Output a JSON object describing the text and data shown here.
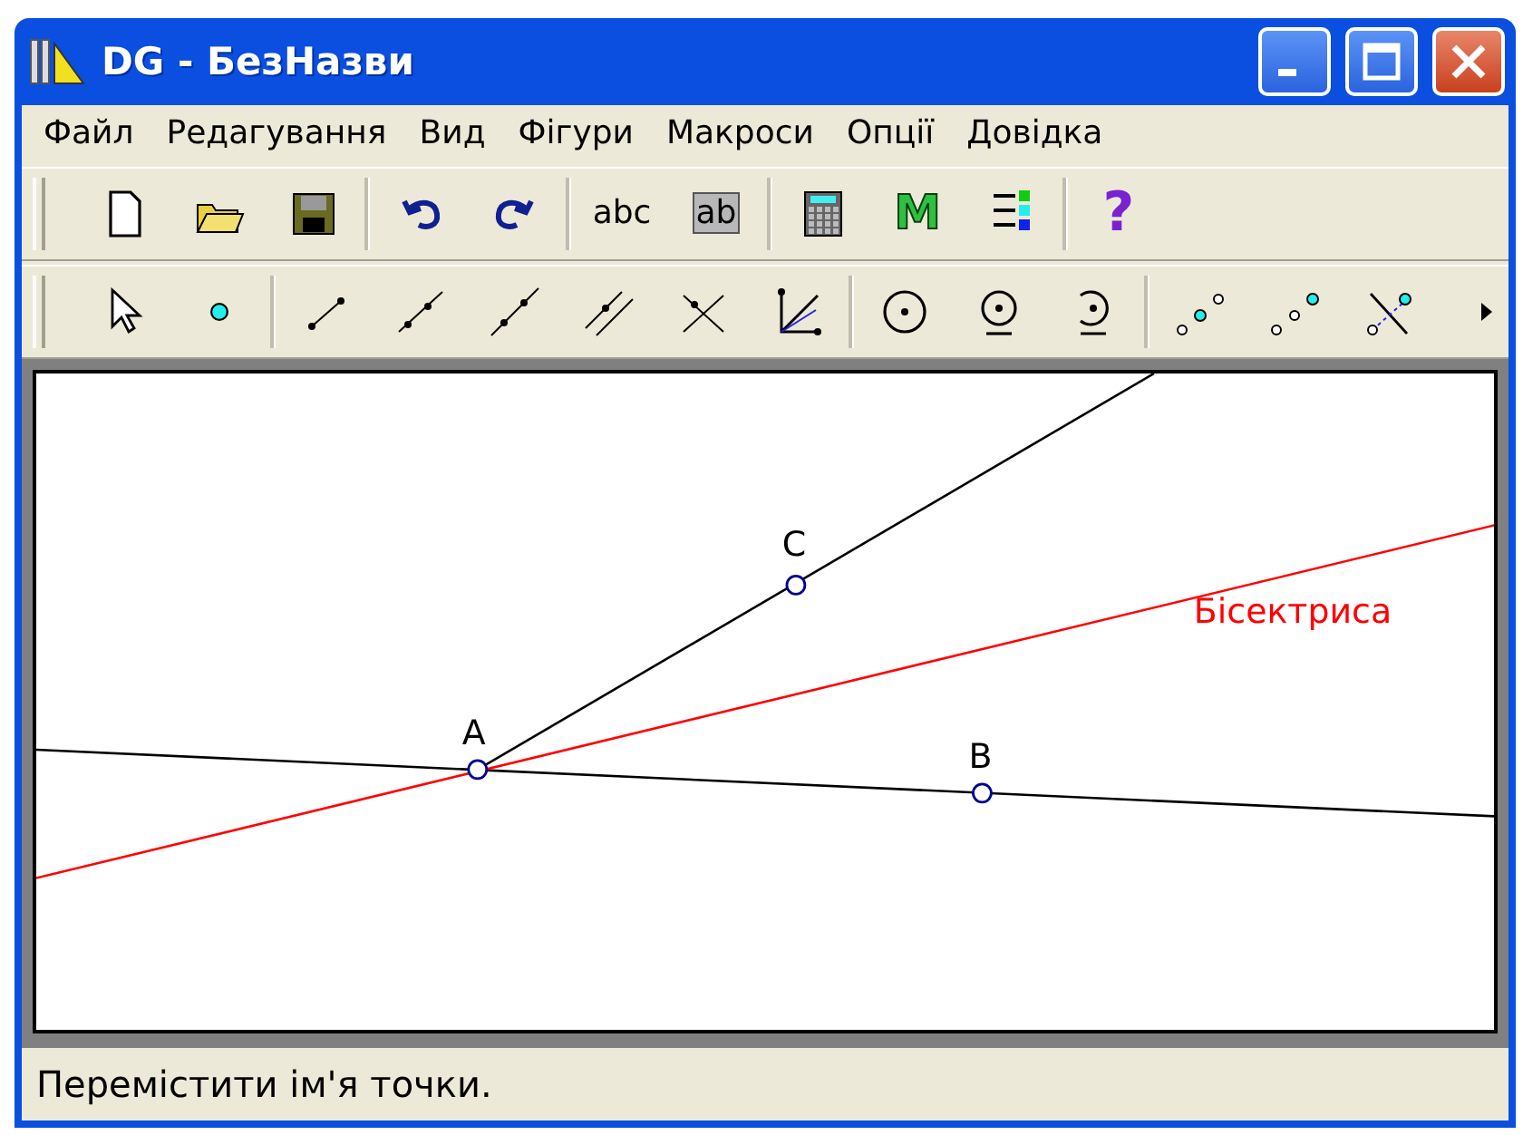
{
  "window": {
    "title": "DG - БезНазви"
  },
  "menu": [
    "Файл",
    "Редагування",
    "Вид",
    "Фігури",
    "Макроси",
    "Опції",
    "Довідка"
  ],
  "toolbar": {
    "text_button": "abc",
    "label_button": "ab",
    "macro_button": "M",
    "help_button": "?"
  },
  "canvas": {
    "points": [
      {
        "label": "A"
      },
      {
        "label": "B"
      },
      {
        "label": "C"
      }
    ],
    "lines": [
      {
        "kind": "line",
        "color": "#000000"
      },
      {
        "kind": "ray",
        "color": "#000000"
      },
      {
        "kind": "bisector",
        "color": "#ff0000",
        "label": "Бісектриса"
      }
    ]
  },
  "status_bar": "Перемістити ім'я точки."
}
